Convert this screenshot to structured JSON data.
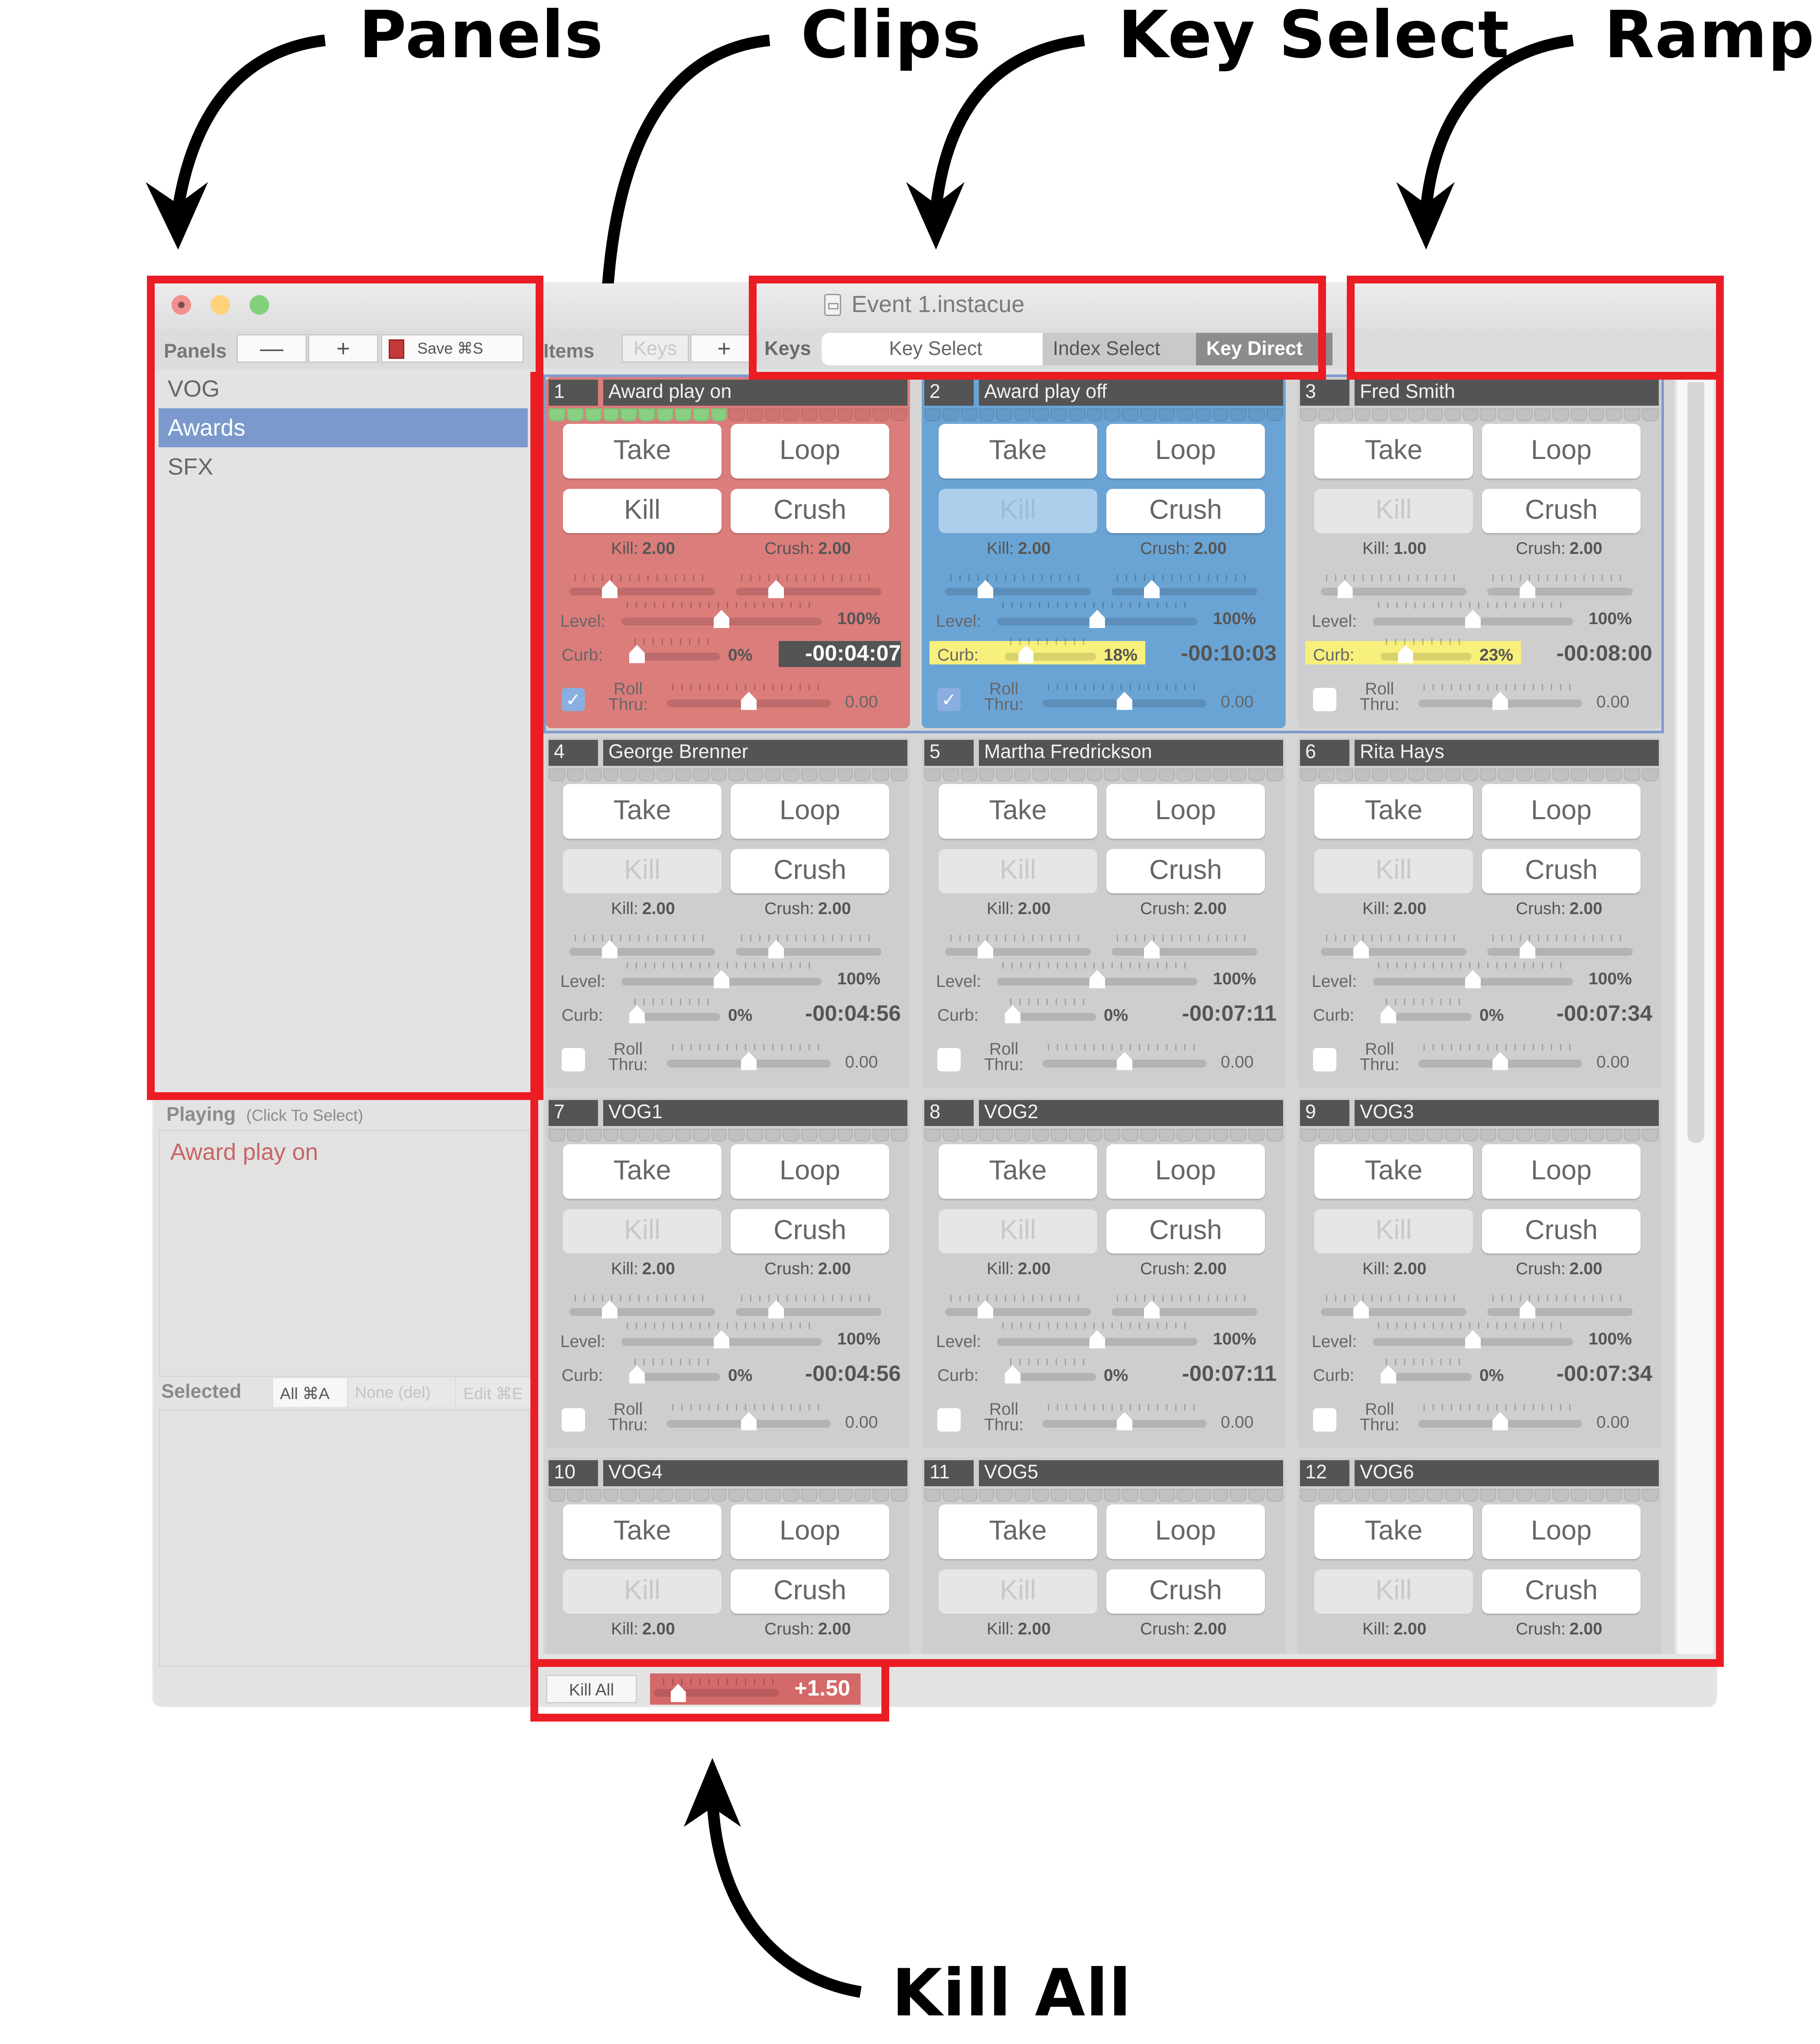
{
  "annotations": {
    "panels": "Panels",
    "clips": "Clips",
    "key_select": "Key Select",
    "ramp": "Ramp",
    "kill_all": "Kill All"
  },
  "window": {
    "title": "Event 1.instacue",
    "traffic_lights": [
      "close",
      "minimize",
      "maximize"
    ]
  },
  "toolbar": {
    "panels_label": "Panels",
    "remove_panel": "—",
    "add_panel": "+",
    "save_label": "Save ⌘S",
    "items_label": "Items",
    "items_remove_ghost": "Keys",
    "items_add": "+",
    "keys_label": "Keys",
    "mode_segments": [
      {
        "label": "Key Select",
        "state": "selected"
      },
      {
        "label": "Index Select",
        "state": "normal"
      },
      {
        "label": "Key Direct",
        "state": "active"
      }
    ],
    "ramp_label": "Ramp",
    "ramp_value": "+1.50",
    "ramp_position": 0.2
  },
  "sidebar": {
    "panels": [
      {
        "label": "VOG",
        "selected": false
      },
      {
        "label": "Awards",
        "selected": true
      },
      {
        "label": "SFX",
        "selected": false
      }
    ],
    "playing_title": "Playing",
    "playing_hint": "(Click To Select)",
    "playing_items": [
      "Award play on"
    ],
    "selected_title": "Selected",
    "selected_all": "All ⌘A",
    "selected_none": "None (del)",
    "selected_edit": "Edit ⌘E"
  },
  "colors": {
    "playing_clip": "#db7d7b",
    "selected_clip": "#6aa4d5",
    "idle_clip": "#cecece",
    "highlight": "#f8f07c",
    "annotation_box": "#ec1c24",
    "selection_outline": "#7f9bd0"
  },
  "labels": {
    "take": "Take",
    "loop": "Loop",
    "kill": "Kill",
    "crush": "Crush",
    "kill_prefix": "Kill:",
    "crush_prefix": "Crush:",
    "level": "Level:",
    "curb": "Curb:",
    "roll": "Roll",
    "thru": "Thru:"
  },
  "clips": [
    {
      "index": "1",
      "name": "Award play on",
      "state": "playing",
      "progress_steps": 10,
      "total_steps": 20,
      "kill_enabled": true,
      "kill": "2.00",
      "crush": "2.00",
      "level": "100%",
      "curb": "0%",
      "curb_highlight": false,
      "time": "-00:04:07",
      "time_inverted": true,
      "roll_checked": true,
      "roll": "0.00",
      "kill_pos": 0.25,
      "crush_pos": 0.25,
      "level_pos": 0.5,
      "curb_pos": 0.0,
      "roll_pos": 0.5
    },
    {
      "index": "2",
      "name": "Award play off",
      "state": "selected",
      "progress_steps": 0,
      "total_steps": 20,
      "kill_enabled": false,
      "kill": "2.00",
      "crush": "2.00",
      "level": "100%",
      "curb": "18%",
      "curb_highlight": true,
      "time": "-00:10:03",
      "time_inverted": false,
      "roll_checked": true,
      "roll": "0.00",
      "kill_pos": 0.25,
      "crush_pos": 0.25,
      "level_pos": 0.5,
      "curb_pos": 0.18,
      "roll_pos": 0.5
    },
    {
      "index": "3",
      "name": "Fred Smith",
      "state": "idle",
      "progress_steps": 0,
      "total_steps": 20,
      "kill_enabled": false,
      "kill": "1.00",
      "crush": "2.00",
      "level": "100%",
      "curb": "23%",
      "curb_highlight": true,
      "time": "-00:08:00",
      "time_inverted": false,
      "roll_checked": false,
      "roll": "0.00",
      "kill_pos": 0.125,
      "crush_pos": 0.25,
      "level_pos": 0.5,
      "curb_pos": 0.23,
      "roll_pos": 0.5
    },
    {
      "index": "4",
      "name": "George Brenner",
      "state": "idle",
      "progress_steps": 0,
      "total_steps": 20,
      "kill_enabled": false,
      "kill": "2.00",
      "crush": "2.00",
      "level": "100%",
      "curb": "0%",
      "curb_highlight": false,
      "time": "-00:04:56",
      "time_inverted": false,
      "roll_checked": false,
      "roll": "0.00",
      "kill_pos": 0.25,
      "crush_pos": 0.25,
      "level_pos": 0.5,
      "curb_pos": 0.0,
      "roll_pos": 0.5
    },
    {
      "index": "5",
      "name": "Martha Fredrickson",
      "state": "idle",
      "progress_steps": 0,
      "total_steps": 20,
      "kill_enabled": false,
      "kill": "2.00",
      "crush": "2.00",
      "level": "100%",
      "curb": "0%",
      "curb_highlight": false,
      "time": "-00:07:11",
      "time_inverted": false,
      "roll_checked": false,
      "roll": "0.00",
      "kill_pos": 0.25,
      "crush_pos": 0.25,
      "level_pos": 0.5,
      "curb_pos": 0.0,
      "roll_pos": 0.5
    },
    {
      "index": "6",
      "name": "Rita Hays",
      "state": "idle",
      "progress_steps": 0,
      "total_steps": 20,
      "kill_enabled": false,
      "kill": "2.00",
      "crush": "2.00",
      "level": "100%",
      "curb": "0%",
      "curb_highlight": false,
      "time": "-00:07:34",
      "time_inverted": false,
      "roll_checked": false,
      "roll": "0.00",
      "kill_pos": 0.25,
      "crush_pos": 0.25,
      "level_pos": 0.5,
      "curb_pos": 0.0,
      "roll_pos": 0.5
    },
    {
      "index": "7",
      "name": "VOG1",
      "state": "idle",
      "progress_steps": 0,
      "total_steps": 20,
      "kill_enabled": false,
      "kill": "2.00",
      "crush": "2.00",
      "level": "100%",
      "curb": "0%",
      "curb_highlight": false,
      "time": "-00:04:56",
      "time_inverted": false,
      "roll_checked": false,
      "roll": "0.00",
      "kill_pos": 0.25,
      "crush_pos": 0.25,
      "level_pos": 0.5,
      "curb_pos": 0.0,
      "roll_pos": 0.5
    },
    {
      "index": "8",
      "name": "VOG2",
      "state": "idle",
      "progress_steps": 0,
      "total_steps": 20,
      "kill_enabled": false,
      "kill": "2.00",
      "crush": "2.00",
      "level": "100%",
      "curb": "0%",
      "curb_highlight": false,
      "time": "-00:07:11",
      "time_inverted": false,
      "roll_checked": false,
      "roll": "0.00",
      "kill_pos": 0.25,
      "crush_pos": 0.25,
      "level_pos": 0.5,
      "curb_pos": 0.0,
      "roll_pos": 0.5
    },
    {
      "index": "9",
      "name": "VOG3",
      "state": "idle",
      "progress_steps": 0,
      "total_steps": 20,
      "kill_enabled": false,
      "kill": "2.00",
      "crush": "2.00",
      "level": "100%",
      "curb": "0%",
      "curb_highlight": false,
      "time": "-00:07:34",
      "time_inverted": false,
      "roll_checked": false,
      "roll": "0.00",
      "kill_pos": 0.25,
      "crush_pos": 0.25,
      "level_pos": 0.5,
      "curb_pos": 0.0,
      "roll_pos": 0.5
    },
    {
      "index": "10",
      "name": "VOG4",
      "state": "idle",
      "progress_steps": 0,
      "total_steps": 20,
      "kill_enabled": false,
      "kill": "2.00",
      "crush": "2.00",
      "partial": true
    },
    {
      "index": "11",
      "name": "VOG5",
      "state": "idle",
      "progress_steps": 0,
      "total_steps": 20,
      "kill_enabled": false,
      "kill": "2.00",
      "crush": "2.00",
      "partial": true
    },
    {
      "index": "12",
      "name": "VOG6",
      "state": "idle",
      "progress_steps": 0,
      "total_steps": 20,
      "kill_enabled": false,
      "kill": "2.00",
      "crush": "2.00",
      "partial": true
    }
  ],
  "footer": {
    "kill_all_label": "Kill All",
    "kill_all_ramp_value": "+1.50",
    "kill_all_ramp_position": 0.15
  }
}
